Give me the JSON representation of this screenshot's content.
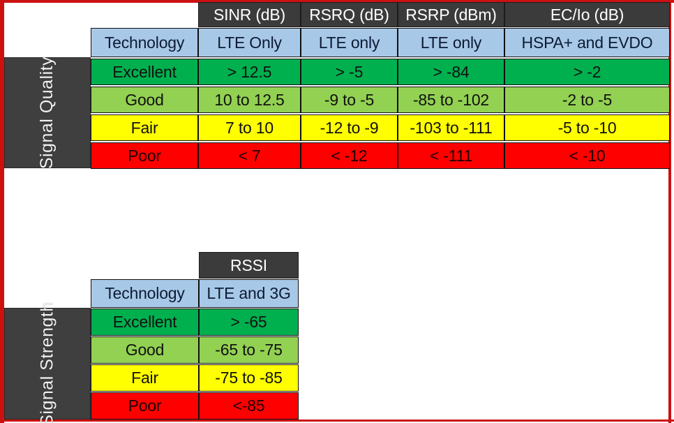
{
  "tables": [
    {
      "id": "signal-quality",
      "side_label": "Signal Quality",
      "columns": [
        {
          "header": "SINR (dB)",
          "technology": "LTE Only"
        },
        {
          "header": "RSRQ (dB)",
          "technology": "LTE only"
        },
        {
          "header": "RSRP (dBm)",
          "technology": "LTE only"
        },
        {
          "header": "EC/Io (dB)",
          "technology": "HSPA+ and EVDO"
        }
      ],
      "row_header_label": "Technology",
      "rows": [
        {
          "label": "Excellent",
          "quality": "excellent",
          "values": [
            "> 12.5",
            "> -5",
            "> -84",
            "> -2"
          ]
        },
        {
          "label": "Good",
          "quality": "good",
          "values": [
            "10 to 12.5",
            "-9 to -5",
            "-85 to -102",
            "-2 to -5"
          ]
        },
        {
          "label": "Fair",
          "quality": "fair",
          "values": [
            "7 to 10",
            "-12 to -9",
            "-103 to -111",
            "-5 to -10"
          ]
        },
        {
          "label": "Poor",
          "quality": "poor",
          "values": [
            "< 7",
            "< -12",
            "< -111",
            "< -10"
          ]
        }
      ]
    },
    {
      "id": "signal-strength",
      "side_label": "Signal Strength",
      "columns": [
        {
          "header": "RSSI",
          "technology": "LTE and 3G"
        }
      ],
      "row_header_label": "Technology",
      "rows": [
        {
          "label": "Excellent",
          "quality": "excellent",
          "values": [
            "> -65"
          ]
        },
        {
          "label": "Good",
          "quality": "good",
          "values": [
            "-65 to -75"
          ]
        },
        {
          "label": "Fair",
          "quality": "fair",
          "values": [
            "-75 to -85"
          ]
        },
        {
          "label": "Poor",
          "quality": "poor",
          "values": [
            "<-85"
          ]
        }
      ]
    }
  ],
  "colors": {
    "header_bg": "#3b3b3b",
    "technology_bg": "#a8c8e8",
    "excellent": "#00b04f",
    "good": "#93d152",
    "fair": "#ffff00",
    "poor": "#ff0000",
    "side_label_bg": "#3f3f3f",
    "frame": "#cc1111"
  }
}
